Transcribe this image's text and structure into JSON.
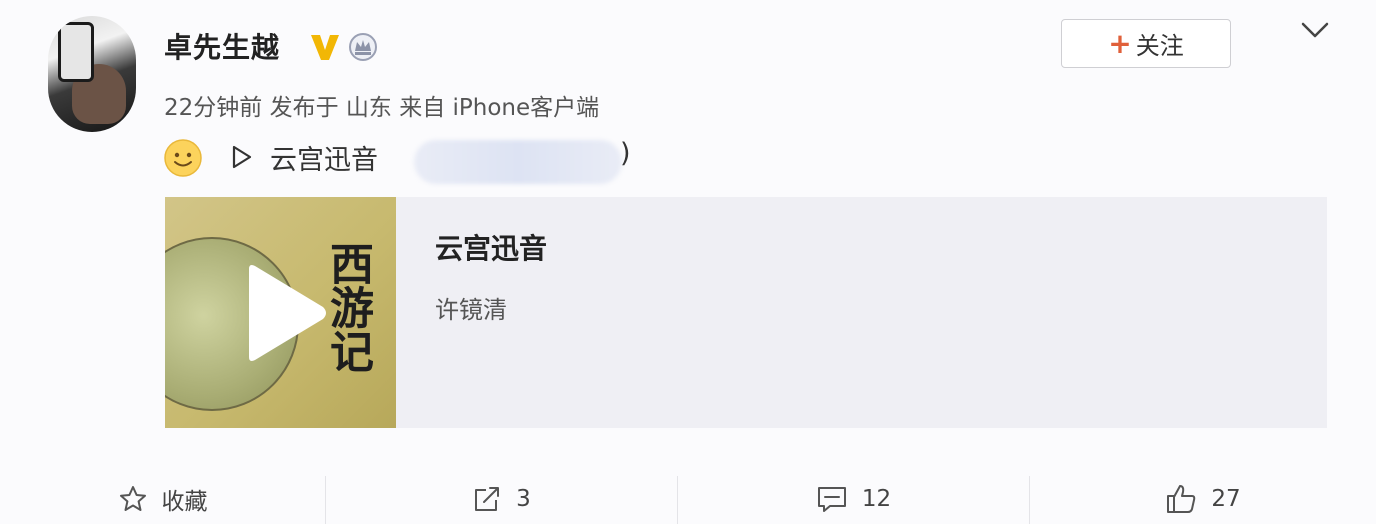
{
  "post": {
    "username": "卓先生越",
    "meta": "22分钟前 发布于 山东 来自 iPhone客户端",
    "follow_label": "关注",
    "music_link_text": "云宫迅音",
    "close_paren": ")"
  },
  "card": {
    "title": "云宫迅音",
    "artist": "许镜清",
    "cover_title": "西游记"
  },
  "actions": {
    "favorite_label": "收藏",
    "share_count": "3",
    "comment_count": "12",
    "like_count": "27"
  },
  "colors": {
    "follow_plus": "#e0603a",
    "verified_v": "#f2b705",
    "card_background": "#efeff4"
  },
  "icons": {
    "verified": "verified-v-icon",
    "badge": "crown-badge-icon",
    "dropdown": "chevron-down-icon",
    "emoji": "smile-emoji-icon",
    "play": "play-icon",
    "favorite": "star-icon",
    "share": "share-icon",
    "comment": "comment-icon",
    "like": "thumbs-up-icon"
  }
}
